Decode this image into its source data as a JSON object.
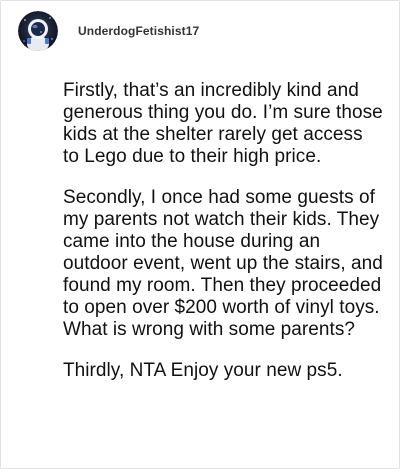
{
  "comment": {
    "author": "UnderdogFetishist17",
    "paragraphs": [
      "Firstly, that’s an incredibly kind and generous thing you do. I’m sure those kids at the shelter rarely get access to Lego due to their high price.",
      "Secondly, I once had some guests of my parents not watch their kids. They came into the house during an outdoor event, went up the stairs, and found my room. Then they proceeded to open over $200 worth of vinyl toys. What is wrong with some parents?",
      "Thirdly, NTA Enjoy your new ps5."
    ]
  },
  "avatar_icon": "astronaut-avatar-icon"
}
